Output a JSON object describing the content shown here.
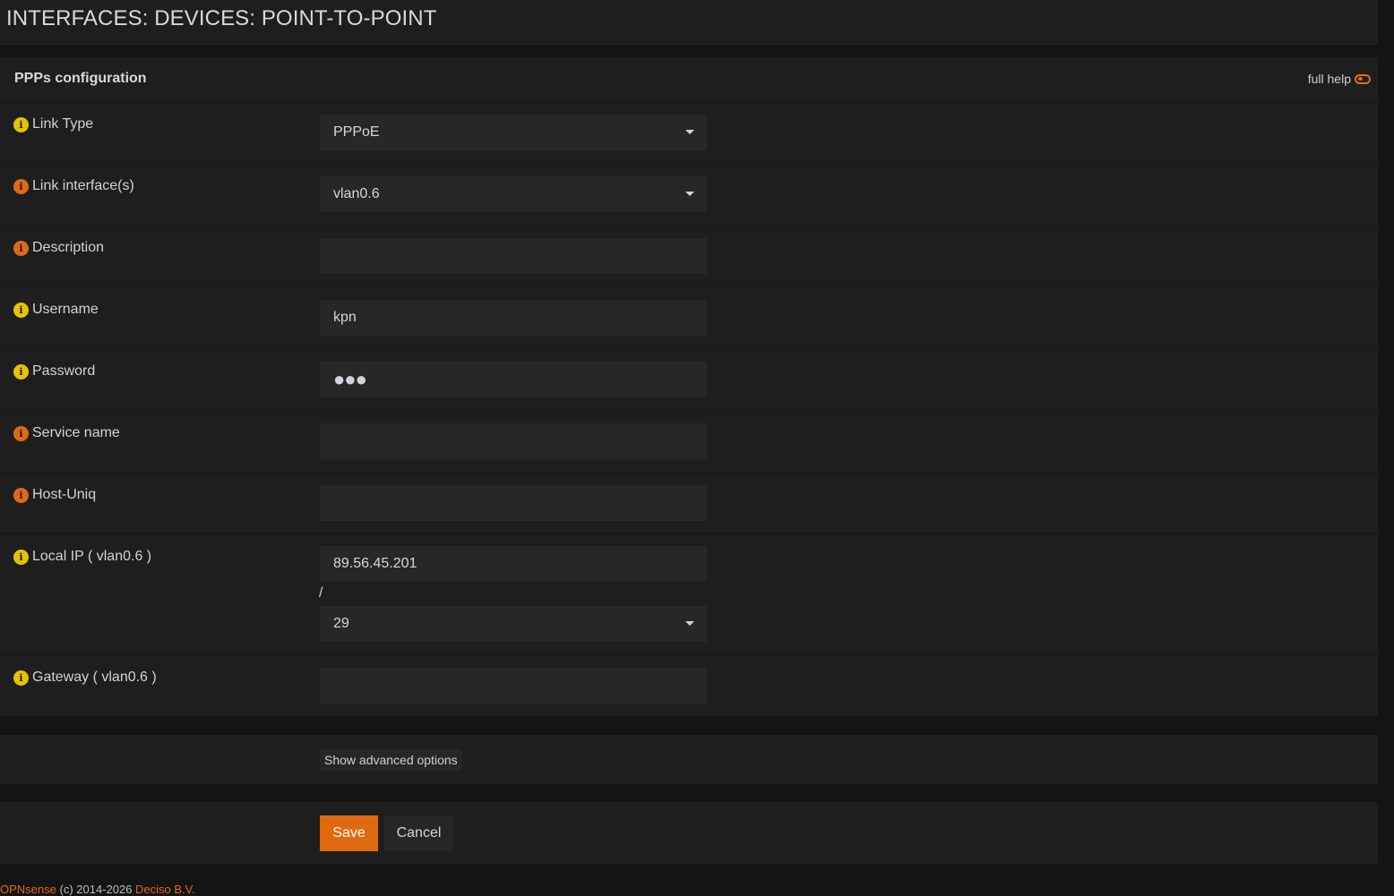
{
  "page": {
    "title": "INTERFACES: DEVICES: POINT-TO-POINT"
  },
  "panel": {
    "title": "PPPs configuration",
    "full_help_label": "full help",
    "full_help_icon": "toggle-icon"
  },
  "fields": {
    "link_type": {
      "label": "Link Type",
      "value": "PPPoE",
      "icon_color": "#e8c200"
    },
    "link_interface": {
      "label": "Link interface(s)",
      "value": "vlan0.6",
      "icon_color": "#e06a12"
    },
    "description": {
      "label": "Description",
      "value": "",
      "icon_color": "#e06a12"
    },
    "username": {
      "label": "Username",
      "value": "kpn",
      "icon_color": "#e8c200"
    },
    "password": {
      "label": "Password",
      "value": "●●●",
      "icon_color": "#e8c200"
    },
    "service_name": {
      "label": "Service name",
      "value": "",
      "icon_color": "#e06a12"
    },
    "host_uniq": {
      "label": "Host-Uniq",
      "value": "",
      "icon_color": "#e06a12"
    },
    "local_ip": {
      "label": "Local IP ( vlan0.6 )",
      "value": "89.56.45.201",
      "separator": "/",
      "subnet": "29",
      "icon_color": "#e8c200"
    },
    "gateway": {
      "label": "Gateway ( vlan0.6 )",
      "value": "",
      "icon_color": "#e8c200"
    }
  },
  "advanced": {
    "button_label": "Show advanced options"
  },
  "actions": {
    "save_label": "Save",
    "cancel_label": "Cancel",
    "save_color": "#e0690f"
  },
  "footer": {
    "brand": "OPNsense",
    "copyright": " (c) 2014-2026 ",
    "company": "Deciso B.V."
  }
}
